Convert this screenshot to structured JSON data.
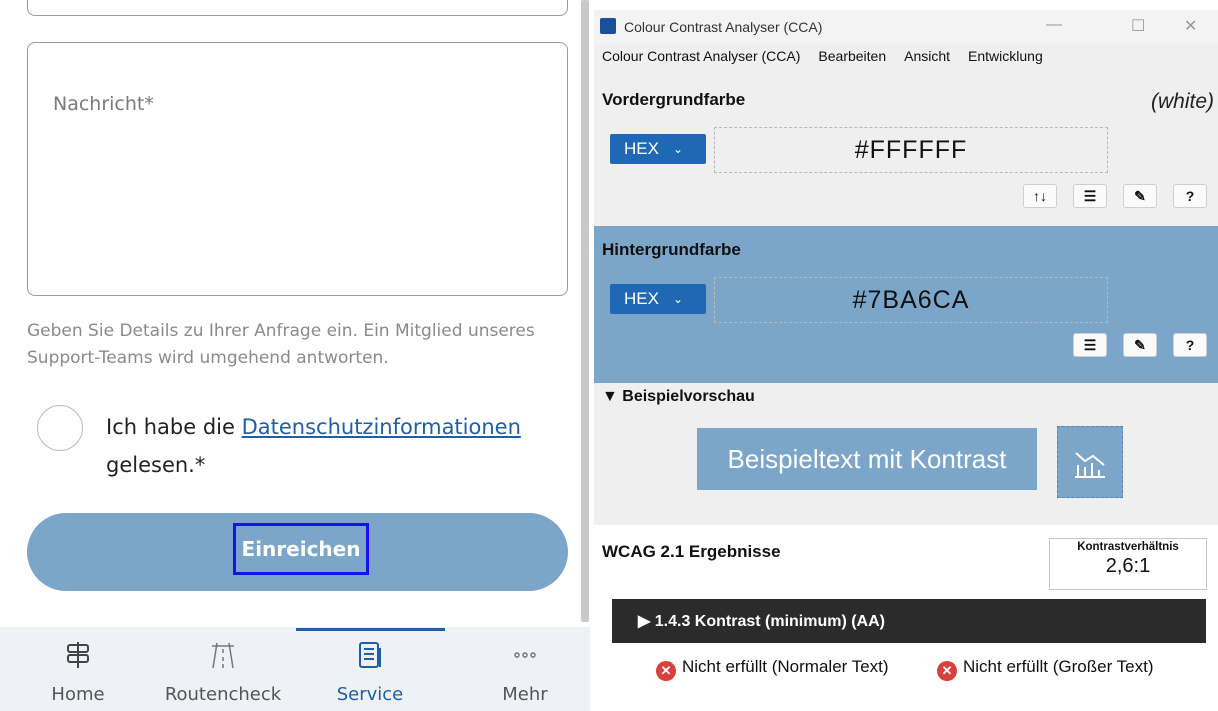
{
  "app": {
    "message_placeholder": "Nachricht*",
    "helper_text": "Geben Sie Details zu Ihrer Anfrage ein. Ein Mitglied unseres Support-Teams wird umgehend antworten.",
    "consent_prefix": "Ich habe die ",
    "consent_link": "Datenschutzinformationen",
    "consent_suffix": "gelesen.*",
    "submit_label": "Einreichen",
    "tabs": [
      {
        "label": "Home",
        "icon": "signpost-icon"
      },
      {
        "label": "Routencheck",
        "icon": "road-icon"
      },
      {
        "label": "Service",
        "icon": "document-icon",
        "active": true
      },
      {
        "label": "Mehr",
        "icon": "more-dots-icon"
      }
    ]
  },
  "cca": {
    "window_title": "Colour Contrast Analyser (CCA)",
    "menu": [
      "Colour Contrast Analyser (CCA)",
      "Bearbeiten",
      "Ansicht",
      "Entwicklung"
    ],
    "foreground": {
      "label": "Vordergrundfarbe",
      "color_name": "(white)",
      "format": "HEX",
      "value": "#FFFFFF"
    },
    "background": {
      "label": "Hintergrundfarbe",
      "format": "HEX",
      "value": "#7BA6CA"
    },
    "preview": {
      "label": "▼ Beispielvorschau",
      "sample_text": "Beispieltext mit Kontrast"
    },
    "results": {
      "title": "WCAG 2.1 Ergebnisse",
      "ratio_caption": "Kontrastverhältnis",
      "ratio_value": "2,6:1",
      "criterion": "▶ 1.4.3 Kontrast (minimum) (AA)",
      "normal_text": "Nicht erfüllt (Normaler Text)",
      "large_text": "Nicht erfüllt (Großer Text)"
    }
  },
  "colors": {
    "accent": "#7BA6CA",
    "link": "#1E5FA8",
    "focus": "#1414E6",
    "hex_select": "#1F69B4",
    "fail": "#D9403A"
  }
}
